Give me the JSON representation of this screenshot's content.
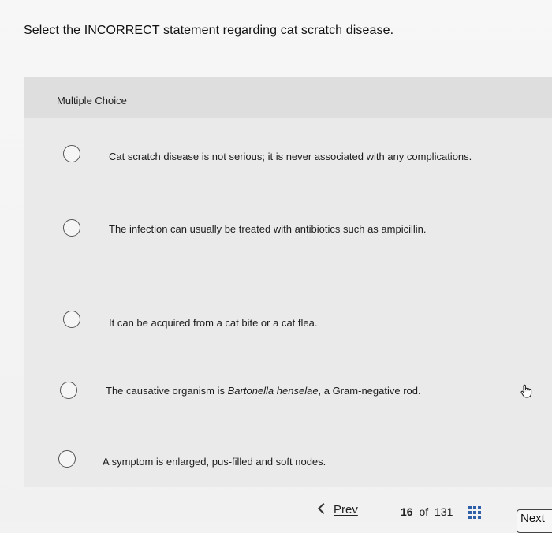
{
  "question": {
    "text": "Select the INCORRECT statement regarding cat scratch disease."
  },
  "panel": {
    "type_label": "Multiple Choice"
  },
  "options": [
    {
      "text": "Cat scratch disease is not serious; it is never associated with any complications."
    },
    {
      "text": "The infection can usually be treated with antibiotics such as ampicillin."
    },
    {
      "text": "It can be acquired from a cat bite or a cat flea."
    },
    {
      "pre": "The causative organism is ",
      "italic": "Bartonella henselae",
      "post": ", a Gram-negative rod."
    },
    {
      "text": "A symptom is enlarged, pus-filled and soft nodes."
    }
  ],
  "nav": {
    "prev_label": "Prev",
    "current": "16",
    "of_label": "of",
    "total": "131",
    "next_label": "Next"
  },
  "icons": {
    "prev": "chevron-left-icon",
    "grid": "grid-icon",
    "cursor": "hand-pointer-icon"
  },
  "colors": {
    "accent": "#2f5fa8"
  }
}
